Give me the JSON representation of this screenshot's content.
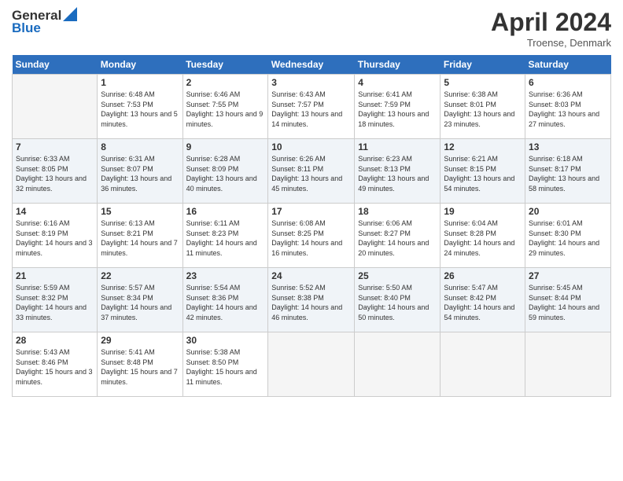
{
  "header": {
    "logo_line1": "General",
    "logo_line2": "Blue",
    "month_title": "April 2024",
    "location": "Troense, Denmark"
  },
  "weekdays": [
    "Sunday",
    "Monday",
    "Tuesday",
    "Wednesday",
    "Thursday",
    "Friday",
    "Saturday"
  ],
  "weeks": [
    [
      {
        "day": "",
        "sunrise": "",
        "sunset": "",
        "daylight": ""
      },
      {
        "day": "1",
        "sunrise": "Sunrise: 6:48 AM",
        "sunset": "Sunset: 7:53 PM",
        "daylight": "Daylight: 13 hours and 5 minutes."
      },
      {
        "day": "2",
        "sunrise": "Sunrise: 6:46 AM",
        "sunset": "Sunset: 7:55 PM",
        "daylight": "Daylight: 13 hours and 9 minutes."
      },
      {
        "day": "3",
        "sunrise": "Sunrise: 6:43 AM",
        "sunset": "Sunset: 7:57 PM",
        "daylight": "Daylight: 13 hours and 14 minutes."
      },
      {
        "day": "4",
        "sunrise": "Sunrise: 6:41 AM",
        "sunset": "Sunset: 7:59 PM",
        "daylight": "Daylight: 13 hours and 18 minutes."
      },
      {
        "day": "5",
        "sunrise": "Sunrise: 6:38 AM",
        "sunset": "Sunset: 8:01 PM",
        "daylight": "Daylight: 13 hours and 23 minutes."
      },
      {
        "day": "6",
        "sunrise": "Sunrise: 6:36 AM",
        "sunset": "Sunset: 8:03 PM",
        "daylight": "Daylight: 13 hours and 27 minutes."
      }
    ],
    [
      {
        "day": "7",
        "sunrise": "Sunrise: 6:33 AM",
        "sunset": "Sunset: 8:05 PM",
        "daylight": "Daylight: 13 hours and 32 minutes."
      },
      {
        "day": "8",
        "sunrise": "Sunrise: 6:31 AM",
        "sunset": "Sunset: 8:07 PM",
        "daylight": "Daylight: 13 hours and 36 minutes."
      },
      {
        "day": "9",
        "sunrise": "Sunrise: 6:28 AM",
        "sunset": "Sunset: 8:09 PM",
        "daylight": "Daylight: 13 hours and 40 minutes."
      },
      {
        "day": "10",
        "sunrise": "Sunrise: 6:26 AM",
        "sunset": "Sunset: 8:11 PM",
        "daylight": "Daylight: 13 hours and 45 minutes."
      },
      {
        "day": "11",
        "sunrise": "Sunrise: 6:23 AM",
        "sunset": "Sunset: 8:13 PM",
        "daylight": "Daylight: 13 hours and 49 minutes."
      },
      {
        "day": "12",
        "sunrise": "Sunrise: 6:21 AM",
        "sunset": "Sunset: 8:15 PM",
        "daylight": "Daylight: 13 hours and 54 minutes."
      },
      {
        "day": "13",
        "sunrise": "Sunrise: 6:18 AM",
        "sunset": "Sunset: 8:17 PM",
        "daylight": "Daylight: 13 hours and 58 minutes."
      }
    ],
    [
      {
        "day": "14",
        "sunrise": "Sunrise: 6:16 AM",
        "sunset": "Sunset: 8:19 PM",
        "daylight": "Daylight: 14 hours and 3 minutes."
      },
      {
        "day": "15",
        "sunrise": "Sunrise: 6:13 AM",
        "sunset": "Sunset: 8:21 PM",
        "daylight": "Daylight: 14 hours and 7 minutes."
      },
      {
        "day": "16",
        "sunrise": "Sunrise: 6:11 AM",
        "sunset": "Sunset: 8:23 PM",
        "daylight": "Daylight: 14 hours and 11 minutes."
      },
      {
        "day": "17",
        "sunrise": "Sunrise: 6:08 AM",
        "sunset": "Sunset: 8:25 PM",
        "daylight": "Daylight: 14 hours and 16 minutes."
      },
      {
        "day": "18",
        "sunrise": "Sunrise: 6:06 AM",
        "sunset": "Sunset: 8:27 PM",
        "daylight": "Daylight: 14 hours and 20 minutes."
      },
      {
        "day": "19",
        "sunrise": "Sunrise: 6:04 AM",
        "sunset": "Sunset: 8:28 PM",
        "daylight": "Daylight: 14 hours and 24 minutes."
      },
      {
        "day": "20",
        "sunrise": "Sunrise: 6:01 AM",
        "sunset": "Sunset: 8:30 PM",
        "daylight": "Daylight: 14 hours and 29 minutes."
      }
    ],
    [
      {
        "day": "21",
        "sunrise": "Sunrise: 5:59 AM",
        "sunset": "Sunset: 8:32 PM",
        "daylight": "Daylight: 14 hours and 33 minutes."
      },
      {
        "day": "22",
        "sunrise": "Sunrise: 5:57 AM",
        "sunset": "Sunset: 8:34 PM",
        "daylight": "Daylight: 14 hours and 37 minutes."
      },
      {
        "day": "23",
        "sunrise": "Sunrise: 5:54 AM",
        "sunset": "Sunset: 8:36 PM",
        "daylight": "Daylight: 14 hours and 42 minutes."
      },
      {
        "day": "24",
        "sunrise": "Sunrise: 5:52 AM",
        "sunset": "Sunset: 8:38 PM",
        "daylight": "Daylight: 14 hours and 46 minutes."
      },
      {
        "day": "25",
        "sunrise": "Sunrise: 5:50 AM",
        "sunset": "Sunset: 8:40 PM",
        "daylight": "Daylight: 14 hours and 50 minutes."
      },
      {
        "day": "26",
        "sunrise": "Sunrise: 5:47 AM",
        "sunset": "Sunset: 8:42 PM",
        "daylight": "Daylight: 14 hours and 54 minutes."
      },
      {
        "day": "27",
        "sunrise": "Sunrise: 5:45 AM",
        "sunset": "Sunset: 8:44 PM",
        "daylight": "Daylight: 14 hours and 59 minutes."
      }
    ],
    [
      {
        "day": "28",
        "sunrise": "Sunrise: 5:43 AM",
        "sunset": "Sunset: 8:46 PM",
        "daylight": "Daylight: 15 hours and 3 minutes."
      },
      {
        "day": "29",
        "sunrise": "Sunrise: 5:41 AM",
        "sunset": "Sunset: 8:48 PM",
        "daylight": "Daylight: 15 hours and 7 minutes."
      },
      {
        "day": "30",
        "sunrise": "Sunrise: 5:38 AM",
        "sunset": "Sunset: 8:50 PM",
        "daylight": "Daylight: 15 hours and 11 minutes."
      },
      {
        "day": "",
        "sunrise": "",
        "sunset": "",
        "daylight": ""
      },
      {
        "day": "",
        "sunrise": "",
        "sunset": "",
        "daylight": ""
      },
      {
        "day": "",
        "sunrise": "",
        "sunset": "",
        "daylight": ""
      },
      {
        "day": "",
        "sunrise": "",
        "sunset": "",
        "daylight": ""
      }
    ]
  ]
}
